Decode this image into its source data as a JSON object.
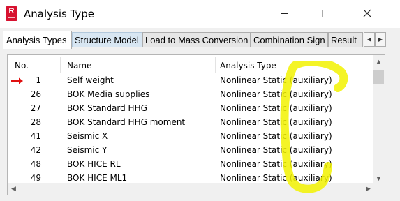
{
  "window": {
    "app_icon_letter": "R",
    "title": "Analysis Type",
    "controls": [
      "minimize-icon",
      "maximize-icon",
      "close-icon"
    ]
  },
  "tabs": [
    {
      "label": "Analysis Types",
      "active": true
    },
    {
      "label": "Structure Model",
      "active": false
    },
    {
      "label": "Load to Mass Conversion",
      "active": false
    },
    {
      "label": "Combination Sign",
      "active": false
    },
    {
      "label": "Result",
      "active": false
    }
  ],
  "table": {
    "columns": {
      "no": "No.",
      "name": "Name",
      "type": "Analysis Type"
    },
    "rows": [
      {
        "no": "1",
        "name": "Self weight",
        "type": "Nonlinear Static (auxiliary)",
        "current": true
      },
      {
        "no": "26",
        "name": "BOK Media supplies",
        "type": "Nonlinear Static (auxiliary)"
      },
      {
        "no": "27",
        "name": "BOK Standard HHG",
        "type": "Nonlinear Static (auxiliary)"
      },
      {
        "no": "28",
        "name": "BOK Standard HHG moment",
        "type": "Nonlinear Static (auxiliary)"
      },
      {
        "no": "41",
        "name": "Seismic X",
        "type": "Nonlinear Static (auxiliary)"
      },
      {
        "no": "42",
        "name": "Seismic Y",
        "type": "Nonlinear Static (auxiliary)"
      },
      {
        "no": "48",
        "name": "BOK HICE RL",
        "type": "Nonlinear Static (auxiliary)"
      },
      {
        "no": "49",
        "name": "BOK HICE ML1",
        "type": "Nonlinear Static (auxiliary)"
      }
    ]
  },
  "colors": {
    "brand": "#d7112f",
    "current_row_arrow": "#e01010",
    "highlighter": "#f2f200"
  }
}
